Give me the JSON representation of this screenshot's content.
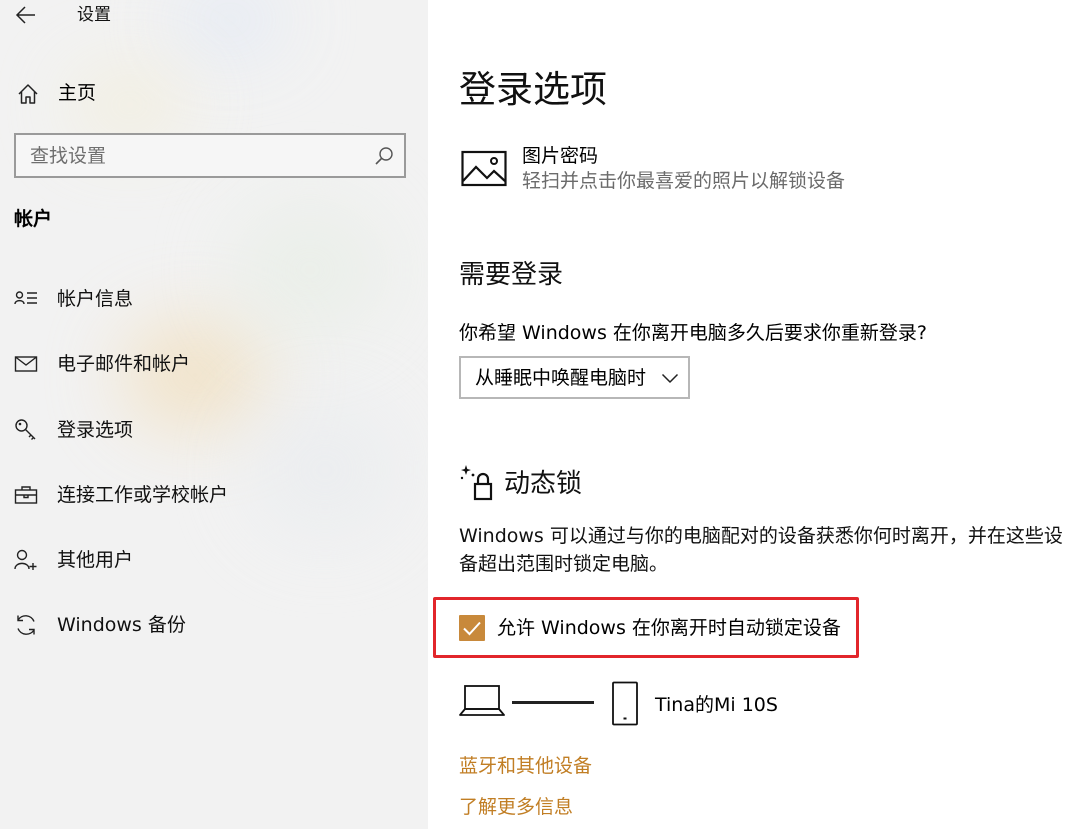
{
  "header": {
    "title": "设置",
    "back_icon": "back-arrow-icon"
  },
  "sidebar": {
    "home": {
      "label": "主页",
      "icon": "home-icon"
    },
    "search": {
      "placeholder": "查找设置",
      "value": "",
      "icon": "search-icon"
    },
    "section_heading": "帐户",
    "items": [
      {
        "label": "帐户信息",
        "icon": "account-info-icon"
      },
      {
        "label": "电子邮件和帐户",
        "icon": "mail-icon"
      },
      {
        "label": "登录选项",
        "icon": "key-icon"
      },
      {
        "label": "连接工作或学校帐户",
        "icon": "briefcase-icon"
      },
      {
        "label": "其他用户",
        "icon": "add-user-icon"
      },
      {
        "label": "Windows 备份",
        "icon": "sync-icon"
      }
    ]
  },
  "main": {
    "page_title": "登录选项",
    "picture_password": {
      "title": "图片密码",
      "description": "轻扫并点击你最喜爱的照片以解锁设备",
      "icon": "picture-icon"
    },
    "require_signin": {
      "heading": "需要登录",
      "question": "你希望 Windows 在你离开电脑多久后要求你重新登录?",
      "dropdown_value": "从睡眠中唤醒电脑时"
    },
    "dynamic_lock": {
      "heading": "动态锁",
      "icon": "dynamic-lock-icon",
      "description": "Windows 可以通过与你的电脑配对的设备获悉你何时离开，并在这些设备超出范围时锁定电脑。",
      "checkbox_label": "允许 Windows 在你离开时自动锁定设备",
      "checkbox_checked": true,
      "paired_device": "Tina的Mi 10S"
    },
    "links": {
      "bluetooth": "蓝牙和其他设备",
      "learn_more": "了解更多信息"
    }
  },
  "colors": {
    "accent": "#c8893b",
    "link": "#c17e24",
    "highlight_frame": "#e2262b",
    "sidebar_bg": "#f2f2f2"
  }
}
